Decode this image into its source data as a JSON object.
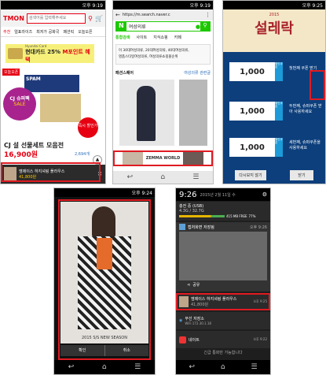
{
  "p1": {
    "time": "오후 9:19",
    "logo": "TMON",
    "search_placeholder": "검색어를 입력해주세요",
    "tabs": [
      "추천",
      "얼표라이즈",
      "최저가 공화국",
      "패션릭",
      "오늘오픈"
    ],
    "banner_card": "Hyundai Card",
    "banner_text": "현대카드 25%",
    "banner_highlight": "M포인트 혜택",
    "badge_top": "오늘오픈",
    "sale_title": "CJ 슈퍼팩",
    "sale_word": "SALE",
    "spam_label": "SPAM",
    "today_badge": "즉시 할인가",
    "product_title": "CJ 설 선물세트 모음전",
    "price": "16,900원",
    "sold_count": "2,694개",
    "ad_brand": "엠제이스 하지셔링 플라우스",
    "ad_price": "41,800원"
  },
  "p2": {
    "time": "오후 9:19",
    "url": "https://m.search.naver.c",
    "n_logo": "N",
    "query": "여성의류",
    "tabs": [
      "통합검색",
      "사이트",
      "지식쇼핑",
      "카페"
    ],
    "autocomplete": [
      "이 30대여성의류, 20대여성의류, 40대여성의류,",
      "명품스타일여성의류, 여성의류쇼핑몰순위"
    ],
    "section": "패션스퀘어",
    "section_link": "여성의류 관련글",
    "ad_brand": "ZEMMA WORLD"
  },
  "p3": {
    "time": "오후 9:25",
    "brand_top": "2015",
    "title": "설레락",
    "coupon_values": [
      "1,000",
      "1,000",
      "1,000"
    ],
    "coupon_word": "원",
    "coupon_side": [
      "할인쿠폰",
      "할인쿠폰",
      "할인쿠폰"
    ],
    "promo_lines": [
      "첫번째 쿠폰 받기",
      "두번째, 슈퍼쿠폰 받아 사용하세요",
      "세번째, 슈퍼쿠폰을 사용하세요"
    ],
    "btn_later": "다시보지 않기",
    "btn_close": "닫기"
  },
  "p4": {
    "time": "오후 9:24",
    "caption": "2015 S/S NEW SEASON",
    "btn_confirm": "확인",
    "btn_cancel": "취소"
  },
  "p5": {
    "time": "9:26",
    "date": "2015년 2월 11일 수",
    "charging": "충전 중 (USB)",
    "usage": "4.3G / 32.7G",
    "storage_label": "415 MB FREE",
    "battery": "77%",
    "notif1_title": "캡처화면 저장됨",
    "notif1_time": "오후 9:26",
    "share_label": "공유",
    "notif2_title": "엠제이스 하지셔링 플라우스",
    "notif2_time": "오후 9:25",
    "notif2_sub": "41,800원",
    "notif3_title": "무선 저장소",
    "notif3_sub": "WiFi 172.30.1.18",
    "notif4_title": "네이트",
    "notif4_time": "오후 9:22",
    "footer": "긴급 통화만 가능합니다"
  }
}
